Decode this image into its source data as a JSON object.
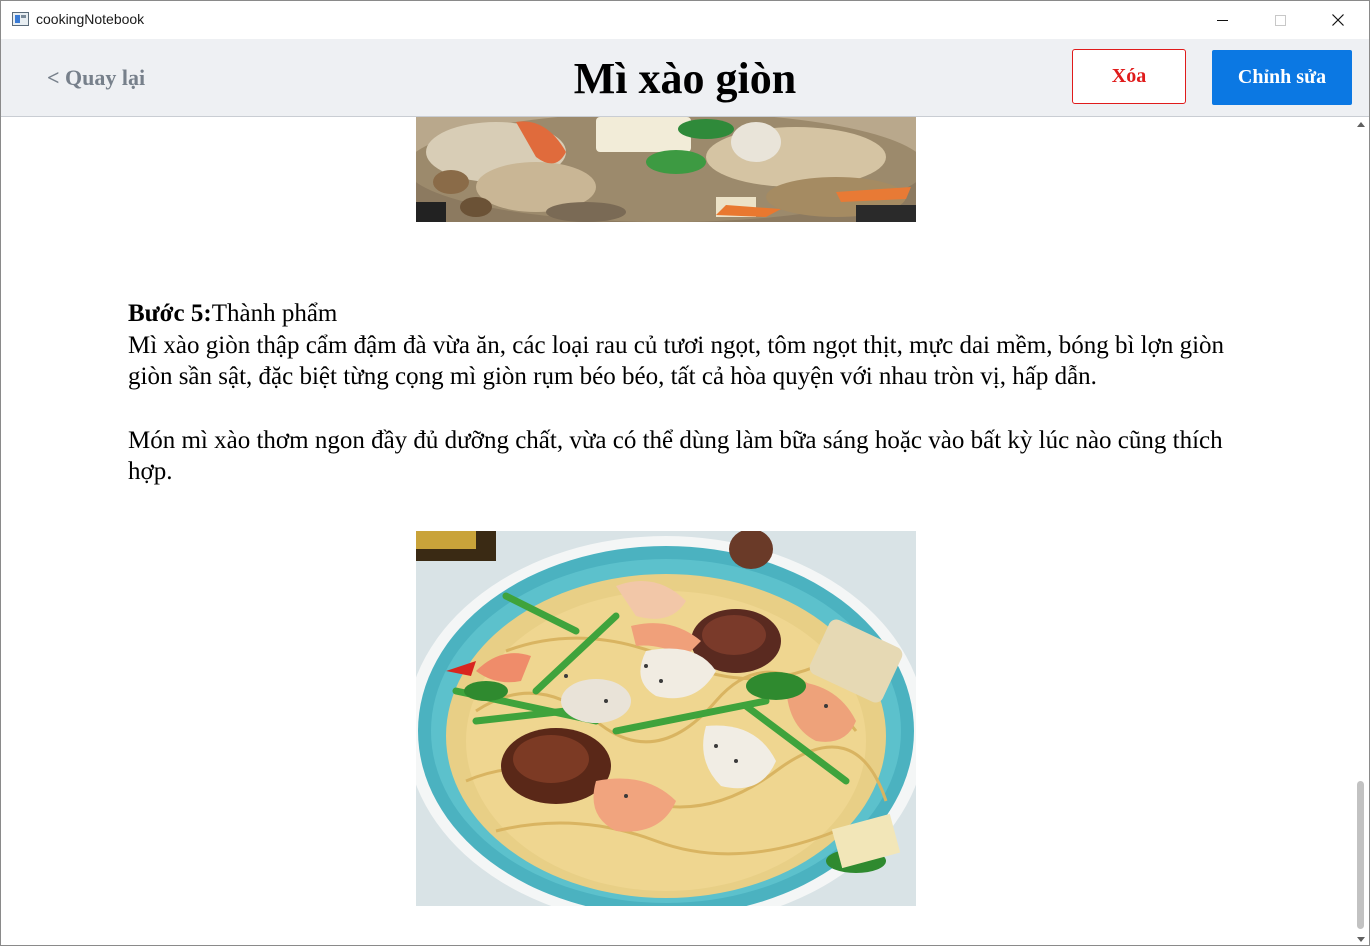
{
  "window": {
    "title": "cookingNotebook",
    "icon": "app-window-icon",
    "controls": [
      "minimize-icon",
      "maximize-icon",
      "close-icon"
    ]
  },
  "header": {
    "back_label": "< Quay lại",
    "title": "Mì xào giòn",
    "delete_label": "Xóa",
    "edit_label": "Chỉnh sửa"
  },
  "step": {
    "label": "Bước 5:",
    "name": "Thành phẩm",
    "paragraph1": "Mì xào giòn thập cẩm đậm đà vừa ăn, các loại rau củ tươi ngọt, tôm ngọt thịt, mực dai mềm, bóng bì lợn giòn giòn sần sật, đặc biệt từng cọng mì giòn rụm béo béo, tất cả hòa quyện với nhau tròn vị, hấp dẫn.",
    "paragraph2": "Món mì xào thơm ngon đầy đủ dưỡng chất, vừa có thể dùng làm bữa sáng hoặc vào bất kỳ lúc nào cũng thích hợp."
  },
  "colors": {
    "header_bg": "#eef0f3",
    "delete": "#e01b1b",
    "edit": "#0b78e3",
    "back": "#77808b"
  }
}
